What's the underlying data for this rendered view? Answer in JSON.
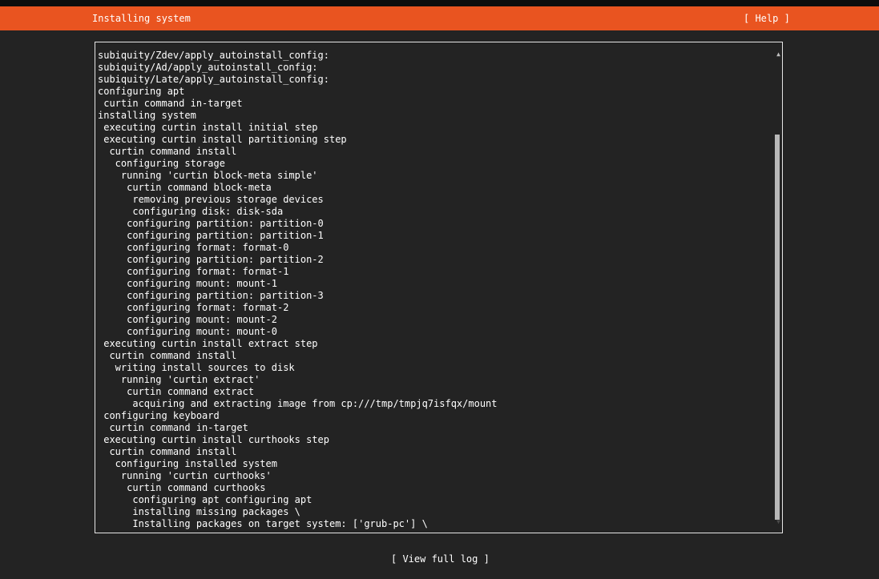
{
  "header": {
    "title": "Installing system",
    "help_label": "[ Help ]"
  },
  "log": {
    "lines": [
      "subiquity/Zdev/apply_autoinstall_config:",
      "subiquity/Ad/apply_autoinstall_config:",
      "subiquity/Late/apply_autoinstall_config:",
      "configuring apt",
      " curtin command in-target",
      "installing system",
      " executing curtin install initial step",
      " executing curtin install partitioning step",
      "  curtin command install",
      "   configuring storage",
      "    running 'curtin block-meta simple'",
      "     curtin command block-meta",
      "      removing previous storage devices",
      "      configuring disk: disk-sda",
      "     configuring partition: partition-0",
      "     configuring partition: partition-1",
      "     configuring format: format-0",
      "     configuring partition: partition-2",
      "     configuring format: format-1",
      "     configuring mount: mount-1",
      "     configuring partition: partition-3",
      "     configuring format: format-2",
      "     configuring mount: mount-2",
      "     configuring mount: mount-0",
      " executing curtin install extract step",
      "  curtin command install",
      "   writing install sources to disk",
      "    running 'curtin extract'",
      "     curtin command extract",
      "      acquiring and extracting image from cp:///tmp/tmpjq7isfqx/mount",
      " configuring keyboard",
      "  curtin command in-target",
      " executing curtin install curthooks step",
      "  curtin command install",
      "   configuring installed system",
      "    running 'curtin curthooks'",
      "     curtin command curthooks",
      "      configuring apt configuring apt",
      "      installing missing packages \\",
      "      Installing packages on target system: ['grub-pc'] \\"
    ],
    "scroll_up_icon": "▲",
    "scroll_down_icon": "▼"
  },
  "footer": {
    "view_log_label": "[ View full log ]"
  },
  "colors": {
    "header_bg": "#e95420",
    "background": "#232323",
    "text": "#ffffff"
  }
}
